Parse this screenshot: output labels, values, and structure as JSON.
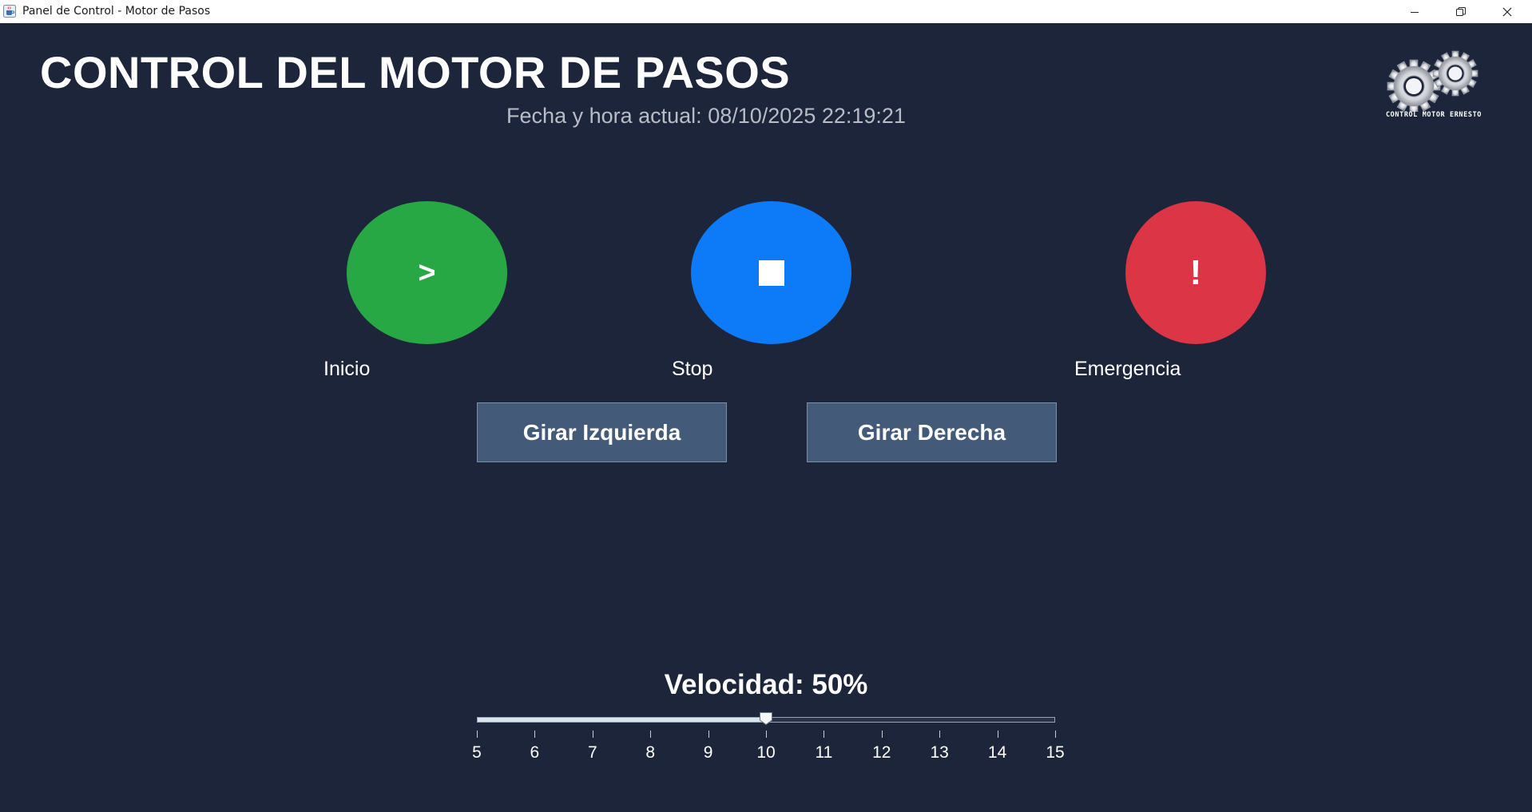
{
  "window": {
    "title": "Panel de Control - Motor de Pasos",
    "icon": "java-cup-icon",
    "controls": [
      "minimize-icon",
      "restore-icon",
      "close-icon"
    ]
  },
  "header": {
    "title": "CONTROL DEL MOTOR DE PASOS",
    "datetime_label": "Fecha y hora actual:",
    "datetime_value": "08/10/2025 22:19:21",
    "logo_text": "CONTROL MOTOR ERNESTO"
  },
  "controls": {
    "start": {
      "glyph": ">",
      "label": "Inicio",
      "color": "#28a745"
    },
    "stop": {
      "glyph": "■",
      "label": "Stop",
      "color": "#0d7bf7"
    },
    "emergency": {
      "glyph": "!",
      "label": "Emergencia",
      "color": "#dc3545"
    }
  },
  "direction": {
    "left_label": "Girar Izquierda",
    "right_label": "Girar Derecha"
  },
  "speed": {
    "label": "Velocidad: 50%",
    "slider": {
      "min": 5,
      "max": 15,
      "value": 10,
      "ticks": [
        "5",
        "6",
        "7",
        "8",
        "9",
        "10",
        "11",
        "12",
        "13",
        "14",
        "15"
      ]
    }
  },
  "colors": {
    "background": "#1c2539",
    "button_secondary": "#435a79",
    "text": "#ffffff",
    "muted_text": "#b8bcc6"
  }
}
